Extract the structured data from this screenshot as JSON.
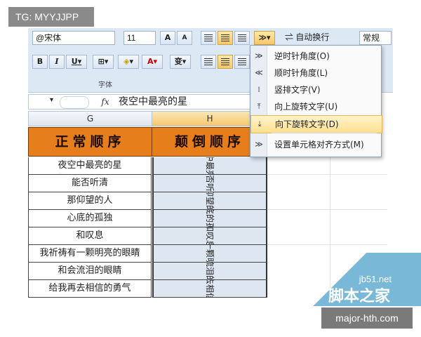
{
  "watermark": {
    "top_left": "TG: MYYJJPP",
    "site_en": "jb51.net",
    "site_cn": "脚本之家",
    "bottom": "major-hth.com"
  },
  "ribbon": {
    "font_name": "@宋体",
    "font_size": "11",
    "wrap_text_label": "自动换行",
    "number_format": "常规",
    "font_group_label": "字体",
    "bold": "B",
    "italic": "I",
    "underline": "U",
    "grow_font": "A",
    "shrink_font": "A",
    "font_color_letter": "A",
    "phonetic": "变"
  },
  "formula_bar": {
    "name_box": "",
    "fx": "fx",
    "content": "夜空中最亮的星"
  },
  "columns": {
    "g": "G",
    "h": "H"
  },
  "headers": {
    "g": "正常顺序",
    "h": "颠倒顺序"
  },
  "rows": [
    {
      "normal": "夜空中最亮的星",
      "rotated": "夜空中最亮的星"
    },
    {
      "normal": "能否听清",
      "rotated": "能否听清"
    },
    {
      "normal": "那仰望的人",
      "rotated": "那仰望的人"
    },
    {
      "normal": "心底的孤独",
      "rotated": "心底的孤独"
    },
    {
      "normal": "和叹息",
      "rotated": "和叹息"
    },
    {
      "normal": "我祈祷有一颗明亮的眼睛",
      "rotated": "我祈祷有一颗明亮的眼睛"
    },
    {
      "normal": "和会流泪的眼睛",
      "rotated": "和会流泪的眼睛"
    },
    {
      "normal": "给我再去相信的勇气",
      "rotated": "给我再去相信的勇气"
    }
  ],
  "orientation_menu": {
    "items": [
      {
        "label": "逆时针角度(O)",
        "icon": "counterclockwise-icon"
      },
      {
        "label": "顺时针角度(L)",
        "icon": "clockwise-icon"
      },
      {
        "label": "竖排文字(V)",
        "icon": "vertical-text-icon"
      },
      {
        "label": "向上旋转文字(U)",
        "icon": "rotate-up-icon"
      },
      {
        "label": "向下旋转文字(D)",
        "icon": "rotate-down-icon",
        "highlighted": true
      },
      {
        "label": "设置单元格对齐方式(M)",
        "icon": "format-alignment-icon"
      }
    ]
  },
  "colors": {
    "header_fill": "#e67e1c",
    "selection_fill": "#dde6f1",
    "menu_highlight": "#ffe08f"
  }
}
